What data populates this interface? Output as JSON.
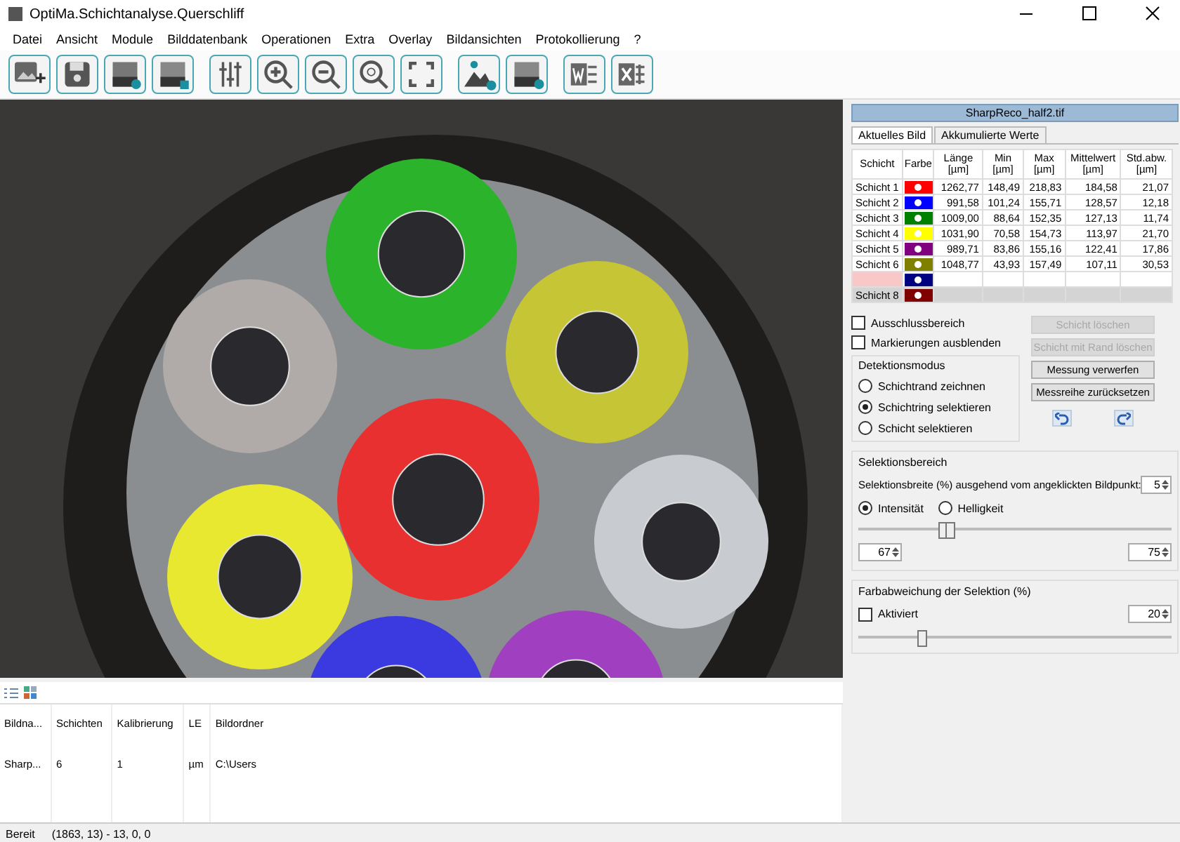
{
  "window": {
    "title": "OptiMa.Schichtanalyse.Querschliff"
  },
  "menu": [
    "Datei",
    "Ansicht",
    "Module",
    "Bilddatenbank",
    "Operationen",
    "Extra",
    "Overlay",
    "Bildansichten",
    "Protokollierung",
    "?"
  ],
  "panel": {
    "file_name": "SharpReco_half2.tif",
    "tabs": [
      {
        "label": "Aktuelles Bild",
        "selected": true
      },
      {
        "label": "Akkumulierte Werte",
        "selected": false
      }
    ],
    "table": {
      "columns": [
        "Schicht",
        "Farbe",
        "Länge [µm]",
        "Min [µm]",
        "Max [µm]",
        "Mittelwert [µm]",
        "Std.abw. [µm]"
      ],
      "rows": [
        {
          "name": "Schicht 1",
          "color": "#ff0000",
          "selected": false,
          "disabled": false,
          "values": [
            "1262,77",
            "148,49",
            "218,83",
            "184,58",
            "21,07"
          ]
        },
        {
          "name": "Schicht 2",
          "color": "#0000ff",
          "selected": false,
          "disabled": false,
          "values": [
            "991,58",
            "101,24",
            "155,71",
            "128,57",
            "12,18"
          ]
        },
        {
          "name": "Schicht 3",
          "color": "#008000",
          "selected": false,
          "disabled": false,
          "values": [
            "1009,00",
            "88,64",
            "152,35",
            "127,13",
            "11,74"
          ]
        },
        {
          "name": "Schicht 4",
          "color": "#ffff00",
          "selected": false,
          "disabled": false,
          "values": [
            "1031,90",
            "70,58",
            "154,73",
            "113,97",
            "21,70"
          ]
        },
        {
          "name": "Schicht 5",
          "color": "#800080",
          "selected": false,
          "disabled": false,
          "values": [
            "989,71",
            "83,86",
            "155,16",
            "122,41",
            "17,86"
          ]
        },
        {
          "name": "Schicht 6",
          "color": "#808000",
          "selected": false,
          "disabled": false,
          "values": [
            "1048,77",
            "43,93",
            "157,49",
            "107,11",
            "30,53"
          ]
        },
        {
          "color": "#000080",
          "selected": true,
          "disabled": false
        },
        {
          "name": "Schicht 8",
          "color": "#800000",
          "selected": false,
          "disabled": true
        }
      ]
    },
    "checkboxes": [
      {
        "label": "Ausschlussbereich",
        "checked": false
      },
      {
        "label": "Markierungen ausblenden",
        "checked": false
      }
    ],
    "detection": {
      "title": "Detektionsmodus",
      "options": [
        {
          "label": "Schichtrand zeichnen",
          "selected": false
        },
        {
          "label": "Schichtring selektieren",
          "selected": true
        },
        {
          "label": "Schicht selektieren",
          "selected": false
        }
      ]
    },
    "buttons": [
      {
        "label": "Schicht löschen",
        "disabled": true
      },
      {
        "label": "Schicht mit Rand löschen",
        "disabled": true
      },
      {
        "label": "Messung verwerfen",
        "disabled": false
      },
      {
        "label": "Messreihe zurücksetzen",
        "disabled": false
      }
    ],
    "selection": {
      "title": "Selektionsbereich",
      "width_label": "Selektionsbreite (%) ausgehend vom angeklickten Bildpunkt:",
      "width_value": "5",
      "modes": [
        {
          "label": "Intensität",
          "selected": true
        },
        {
          "label": "Helligkeit",
          "selected": false
        }
      ],
      "range": [
        {
          "level": 0.27
        },
        {
          "level": 0.29
        }
      ],
      "low_value": "67",
      "high_value": "75"
    },
    "deviation": {
      "title": "Farbabweichung der Selektion (%)",
      "checkbox": {
        "label": "Aktiviert",
        "checked": false
      },
      "value": "20",
      "slider": {
        "level": 0.2
      }
    }
  },
  "image_table": {
    "columns": [
      "Bildna...",
      "Schichten",
      "Kalibrierung",
      "LE",
      "Bildordner"
    ],
    "rows": [
      [
        "Sharp...",
        "6",
        "1",
        "µm",
        "C:\\Users"
      ]
    ]
  },
  "status_bar": {
    "state": "Bereit",
    "position": "(1863, 13) - 13, 0, 0"
  }
}
